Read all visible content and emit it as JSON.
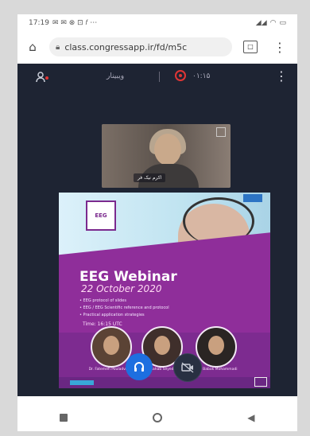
{
  "status_bar": {
    "time": "17:19",
    "status_icons_label": "✉ ✉ ⊗ ⊡ 𝑓 ⋯",
    "signal": "◢◢",
    "wifi": "◠",
    "battery": "▭"
  },
  "browser": {
    "url": "class.congressapp.ir/fd/m5c",
    "tabs_count": "□"
  },
  "meeting": {
    "title": "ویبینار",
    "timer": "۰۱:۱۵"
  },
  "video": {
    "participant_name": "اکرم نیک فر"
  },
  "poster": {
    "logo_text": "EEG",
    "title": "EEG Webinar",
    "date": "22 October 2020",
    "bullets": [
      "EEG protocol of slides",
      "EEG / EEG Scientific reference and protocol",
      "Practical application strategies"
    ],
    "time_text": "Time: 16:15 UTC",
    "speakers": [
      {
        "name": "Dr. Fatemeh Pouladvand"
      },
      {
        "name": "Dr. Shahab Seyed Zehfi"
      },
      {
        "name": "Dr. Babak Mohammadi"
      }
    ]
  },
  "colors": {
    "app_bg": "#1e2433",
    "mic_active": "#1d6fe0",
    "poster_purple": "#8f2e9a",
    "record": "#e03535"
  },
  "icons": [
    "home-icon",
    "lock-icon",
    "tabs-icon",
    "menu-icon",
    "people-icon",
    "record-icon",
    "kebab-icon",
    "mic-icon",
    "camera-icon",
    "expand-icon"
  ]
}
